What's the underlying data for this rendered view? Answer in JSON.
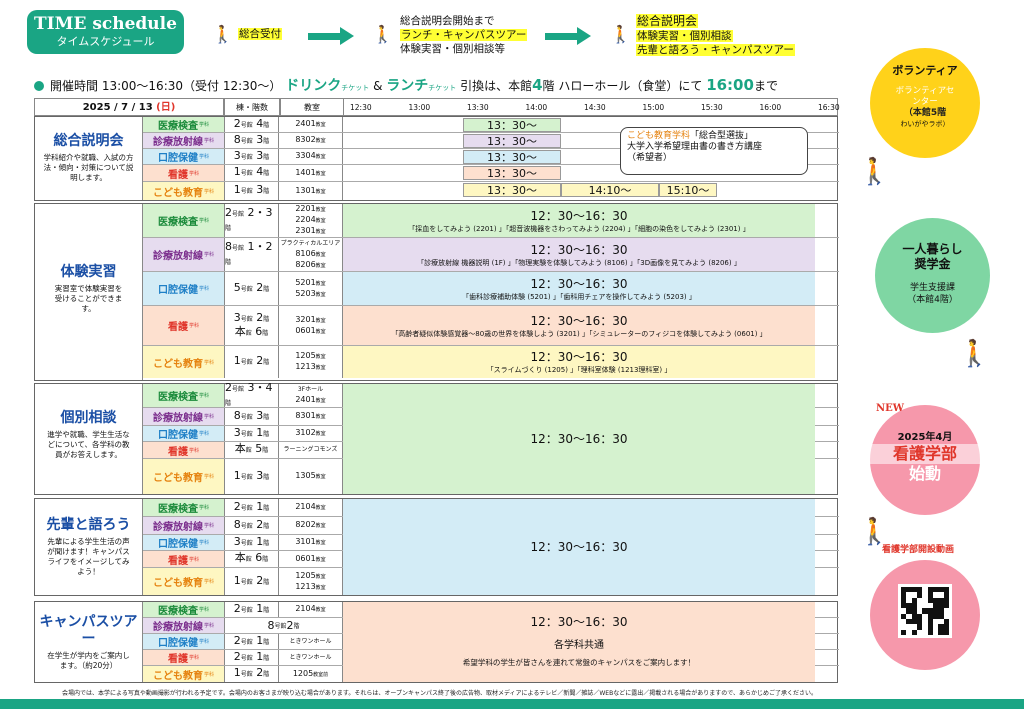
{
  "header": {
    "title_en": "TIME schedule",
    "title_jp": "タイムスケジュール",
    "flow1": "総合受付",
    "flow2_top": "総合説明会開始まで",
    "flow2_a": "ランチ・キャンパスツアー",
    "flow2_b": "体験実習・個別相談等",
    "flow3_top": "総合説明会",
    "flow3_a": "体験実習・個別相談",
    "flow3_b": "先輩と語ろう・キャンパスツアー"
  },
  "hours": {
    "prefix": "開催時間",
    "time": "13:00〜16:30（受付 12:30〜）",
    "drink": "ドリンク",
    "ticket1": "チケット",
    "amp": "&",
    "lunch": "ランチ",
    "ticket2": "チケット",
    "mid": "引換は、本館",
    "floor": "4",
    "mid2": "階 ハローホール（食堂）にて",
    "until": "16:00",
    "end": "まで"
  },
  "grid_header": {
    "date_pre": "2025 / 7 / 13",
    "date_day": "(日)",
    "bldg": "棟・階数",
    "room": "教室",
    "ticks": [
      "12:30",
      "13:00",
      "13:30",
      "14:00",
      "14:30",
      "15:00",
      "15:30",
      "16:00",
      "16:30"
    ]
  },
  "depts": {
    "med": "医療検査",
    "rad": "診療放射線",
    "ora": "口腔保健",
    "nur": "看護",
    "kid": "こども教育",
    "suffix": "学科"
  },
  "blocks": [
    {
      "name": "総合説明会",
      "desc": "学科紹介や就職、入試の方法・傾向・対策について説明します。",
      "rows": [
        {
          "dept": "med",
          "bldg": "2",
          "bldg_s": "号館",
          "floor": "4",
          "floor_s": "階",
          "room": "2401",
          "room_s": "教室"
        },
        {
          "dept": "rad",
          "bldg": "8",
          "bldg_s": "号館",
          "floor": "3",
          "floor_s": "階",
          "room": "8302",
          "room_s": "教室"
        },
        {
          "dept": "ora",
          "bldg": "3",
          "bldg_s": "号館",
          "floor": "3",
          "floor_s": "階",
          "room": "3304",
          "room_s": "教室"
        },
        {
          "dept": "nur",
          "bldg": "1",
          "bldg_s": "号館",
          "floor": "4",
          "floor_s": "階",
          "room": "1401",
          "room_s": "教室"
        },
        {
          "dept": "kid",
          "bldg": "1",
          "bldg_s": "号館",
          "floor": "3",
          "floor_s": "階",
          "room": "1301",
          "room_s": "教室"
        }
      ],
      "slots": [
        "13：30〜",
        "13：30〜",
        "13：30〜",
        "13：30〜",
        "13：30〜",
        "14:10〜",
        "15:10〜"
      ],
      "callout_a": "こども教育学科",
      "callout_b": "「総合型選抜」",
      "callout_c": "大学入学希望理由書の書き方講座",
      "callout_d": "（希望者）"
    },
    {
      "name": "体験実習",
      "desc": "実習室で体験実習を受けることができます。",
      "rows": [
        {
          "dept": "med",
          "bldg": "2",
          "bldg_s": "号館",
          "floor": "2・3",
          "floor_s": "階",
          "rooms": [
            "2201",
            "2204",
            "2301"
          ],
          "room_s": "教室",
          "time": "12：30〜16：30",
          "ex": "「採血をしてみよう (2201) 」「超音波機器をさわってみよう (2204) 」「細胞の染色をしてみよう (2301) 」"
        },
        {
          "dept": "rad",
          "bldg": "8",
          "bldg_s": "号館",
          "floor": "1・2",
          "floor_s": "階",
          "room_pre": "プラクティカルエリア",
          "rooms": [
            "8106",
            "8206"
          ],
          "room_s": "教室",
          "time": "12：30〜16：30",
          "ex": "「診療放射線 機器説明 (1F) 」「物理実験を体験してみよう (8106) 」「3D画像を見てみよう (8206) 」"
        },
        {
          "dept": "ora",
          "bldg": "5",
          "bldg_s": "号館",
          "floor": "2",
          "floor_s": "階",
          "rooms": [
            "5201",
            "5203"
          ],
          "room_s": "教室",
          "time": "12：30〜16：30",
          "ex": "「歯科診療補助体験 (5201) 」「歯科用チェアを操作してみよう (5203) 」"
        },
        {
          "dept": "nur",
          "bldg": "3",
          "bldg_s": "号館",
          "floor": "2",
          "floor_s": "階",
          "bldg2": "本",
          "bldg2_s": "館",
          "floor2": "6",
          "rooms": [
            "3201",
            "0601"
          ],
          "room_s": "教室",
          "time": "12：30〜16：30",
          "ex": "「高齢者疑似体験感覚器〜80歳の世界を体験しよう (3201) 」「シミュレーターのフィジコを体験してみよう (0601) 」"
        },
        {
          "dept": "kid",
          "bldg": "1",
          "bldg_s": "号館",
          "floor": "2",
          "floor_s": "階",
          "rooms": [
            "1205",
            "1213"
          ],
          "room_s": "教室",
          "time": "12：30〜16：30",
          "ex": "「スライムづくり (1205) 」「理科室体験 (1213理科室) 」"
        }
      ]
    },
    {
      "name": "個別相談",
      "desc": "進学や就職、学生生活などについて、各学科の教員がお答えします。",
      "time": "12：30〜16：30",
      "rows": [
        {
          "dept": "med",
          "bldg": "2",
          "bldg_s": "号館",
          "floor": "3・4",
          "floor_s": "階",
          "room_pre": "3Fホール",
          "rooms": [
            "2401"
          ],
          "room_s": "教室"
        },
        {
          "dept": "rad",
          "bldg": "8",
          "bldg_s": "号館",
          "floor": "3",
          "floor_s": "階",
          "rooms": [
            "8301"
          ],
          "room_s": "教室"
        },
        {
          "dept": "ora",
          "bldg": "3",
          "bldg_s": "号館",
          "floor": "1",
          "floor_s": "階",
          "rooms": [
            "3102"
          ],
          "room_s": "教室"
        },
        {
          "dept": "nur",
          "bldg": "本",
          "bldg_s": "館",
          "floor": "5",
          "floor_s": "階",
          "room_text": "ラーニングコモンズ"
        },
        {
          "dept": "kid",
          "bldg": "1",
          "bldg_s": "号館",
          "floor": "3",
          "floor_s": "階",
          "rooms": [
            "1305"
          ],
          "room_s": "教室"
        }
      ]
    },
    {
      "name": "先輩と語ろう",
      "desc": "先輩による学生生活の声が聞けます！キャンパスライフをイメージしてみよう！",
      "time": "12：30〜16：30",
      "rows": [
        {
          "dept": "med",
          "bldg": "2",
          "bldg_s": "号館",
          "floor": "1",
          "floor_s": "階",
          "rooms": [
            "2104"
          ],
          "room_s": "教室"
        },
        {
          "dept": "rad",
          "bldg": "8",
          "bldg_s": "号館",
          "floor": "2",
          "floor_s": "階",
          "rooms": [
            "8202"
          ],
          "room_s": "教室"
        },
        {
          "dept": "ora",
          "bldg": "3",
          "bldg_s": "号館",
          "floor": "1",
          "floor_s": "階",
          "rooms": [
            "3101"
          ],
          "room_s": "教室"
        },
        {
          "dept": "nur",
          "bldg": "本",
          "bldg_s": "館",
          "floor": "6",
          "floor_s": "階",
          "rooms": [
            "0601"
          ],
          "room_s": "教室"
        },
        {
          "dept": "kid",
          "bldg": "1",
          "bldg_s": "号館",
          "floor": "2",
          "floor_s": "階",
          "rooms": [
            "1205",
            "1213"
          ],
          "room_s": "教室"
        }
      ]
    },
    {
      "name": "キャンパスツアー",
      "desc": "在学生が学内をご案内します。（約20分）",
      "time": "12：30〜16：30",
      "common": "各学科共通",
      "note": "希望学科の学生が皆さんを連れて常盤のキャンパスをご案内します！",
      "rows": [
        {
          "dept": "med",
          "bldg": "2",
          "bldg_s": "号館",
          "floor": "1",
          "floor_s": "階",
          "rooms": [
            "2104"
          ],
          "room_s": "教室"
        },
        {
          "dept": "rad",
          "wide": "8",
          "wide_s": "号館",
          "wide_f": "2",
          "wide_fs": "階"
        },
        {
          "dept": "ora",
          "bldg": "2",
          "bldg_s": "号館",
          "floor": "1",
          "floor_s": "階",
          "room_text": "ときワンホール"
        },
        {
          "dept": "nur",
          "bldg": "2",
          "bldg_s": "号館",
          "floor": "1",
          "floor_s": "階",
          "room_text": "ときワンホール"
        },
        {
          "dept": "kid",
          "bldg": "1",
          "bldg_s": "号館",
          "floor": "2",
          "floor_s": "階",
          "rooms": [
            "1205"
          ],
          "room_s": "教室前"
        }
      ]
    }
  ],
  "side": {
    "vol_h": "ボランティア",
    "vol_s1": "ボランティアセンター",
    "vol_s2": "（本館5階",
    "vol_s3": "わいがやラボ）",
    "life_h1": "一人暮らし",
    "life_h2": "奨学金",
    "life_s1": "学生支援課",
    "life_s2": "（本館4階）",
    "new": "NEW",
    "nurse_h1": "2025年4月",
    "nurse_h2": "看護学部",
    "nurse_h3": "始動",
    "video": "看護学部開設動画"
  },
  "footer": "会場内では、本学による写真や動画撮影が行われる予定です。会場内のお客さまが映り込む場合があります。それらは、オープンキャンパス終了後の広告物、取材メディアによるテレビ／新聞／雑誌／WEBなどに露出／掲載される場合がありますので、あらかじめご了承ください。",
  "colors": {
    "accent": "#1aa584",
    "blue": "#1b4fa5",
    "red": "#e0362b"
  }
}
